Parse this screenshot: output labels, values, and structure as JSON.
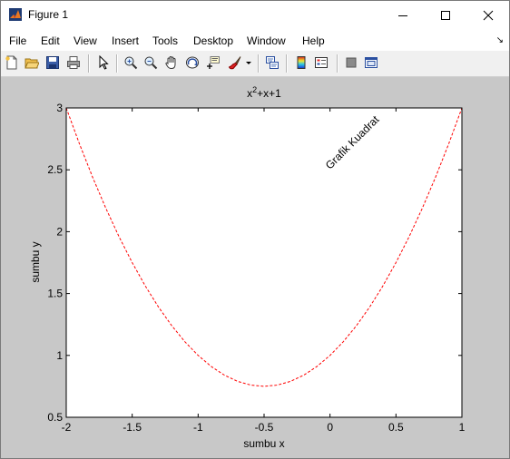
{
  "window": {
    "title": "Figure 1",
    "icon": "matlab-logo-icon",
    "controls": [
      "minimize-icon",
      "maximize-icon",
      "close-icon"
    ]
  },
  "menu": {
    "items": [
      "File",
      "Edit",
      "View",
      "Insert",
      "Tools",
      "Desktop",
      "Window",
      "Help"
    ],
    "dock_icon": "dock-arrow-icon"
  },
  "toolbar": {
    "icons": [
      "new-figure-icon",
      "open-file-icon",
      "save-icon",
      "print-icon",
      "edit-plot-arrow-icon",
      "zoom-in-icon",
      "zoom-out-icon",
      "pan-hand-icon",
      "rotate-3d-icon",
      "data-cursor-icon",
      "brush-icon",
      "link-plot-icon",
      "colorbar-icon",
      "legend-icon",
      "hide-plot-tools-icon",
      "show-plot-tools-icon"
    ]
  },
  "chart_data": {
    "type": "line",
    "title_base": "x",
    "title_sup": "2",
    "title_rest": "+x+1",
    "xlabel": "sumbu x",
    "ylabel": "sumbu y",
    "xlim": [
      -2,
      1
    ],
    "ylim": [
      0.5,
      3
    ],
    "xticks": [
      -2,
      -1.5,
      -1,
      -0.5,
      0,
      0.5,
      1
    ],
    "xtick_labels": [
      "-2",
      "-1.5",
      "-1",
      "-0.5",
      "0",
      "0.5",
      "1"
    ],
    "yticks": [
      0.5,
      1,
      1.5,
      2,
      2.5,
      3
    ],
    "ytick_labels": [
      "0.5",
      "1",
      "1.5",
      "2",
      "2.5",
      "3"
    ],
    "grid": false,
    "series": [
      {
        "color": "#ff0000",
        "style": "dashed",
        "x": [
          -2,
          -1.9,
          -1.8,
          -1.7,
          -1.6,
          -1.5,
          -1.4,
          -1.3,
          -1.2,
          -1.1,
          -1,
          -0.9,
          -0.8,
          -0.7,
          -0.6,
          -0.5,
          -0.4,
          -0.3,
          -0.2,
          -0.1,
          0,
          0.1,
          0.2,
          0.3,
          0.4,
          0.5,
          0.6,
          0.7,
          0.8,
          0.9,
          1
        ],
        "y": [
          3,
          2.71,
          2.44,
          2.19,
          1.96,
          1.75,
          1.56,
          1.39,
          1.24,
          1.11,
          1,
          0.91,
          0.84,
          0.79,
          0.76,
          0.75,
          0.76,
          0.79,
          0.84,
          0.91,
          1,
          1.11,
          1.24,
          1.39,
          1.56,
          1.75,
          1.96,
          2.19,
          2.44,
          2.71,
          3
        ]
      }
    ],
    "annotation": {
      "text": "Grafik Kuadrat",
      "x": 0,
      "y": 2.5,
      "rotation_deg": 45
    }
  }
}
